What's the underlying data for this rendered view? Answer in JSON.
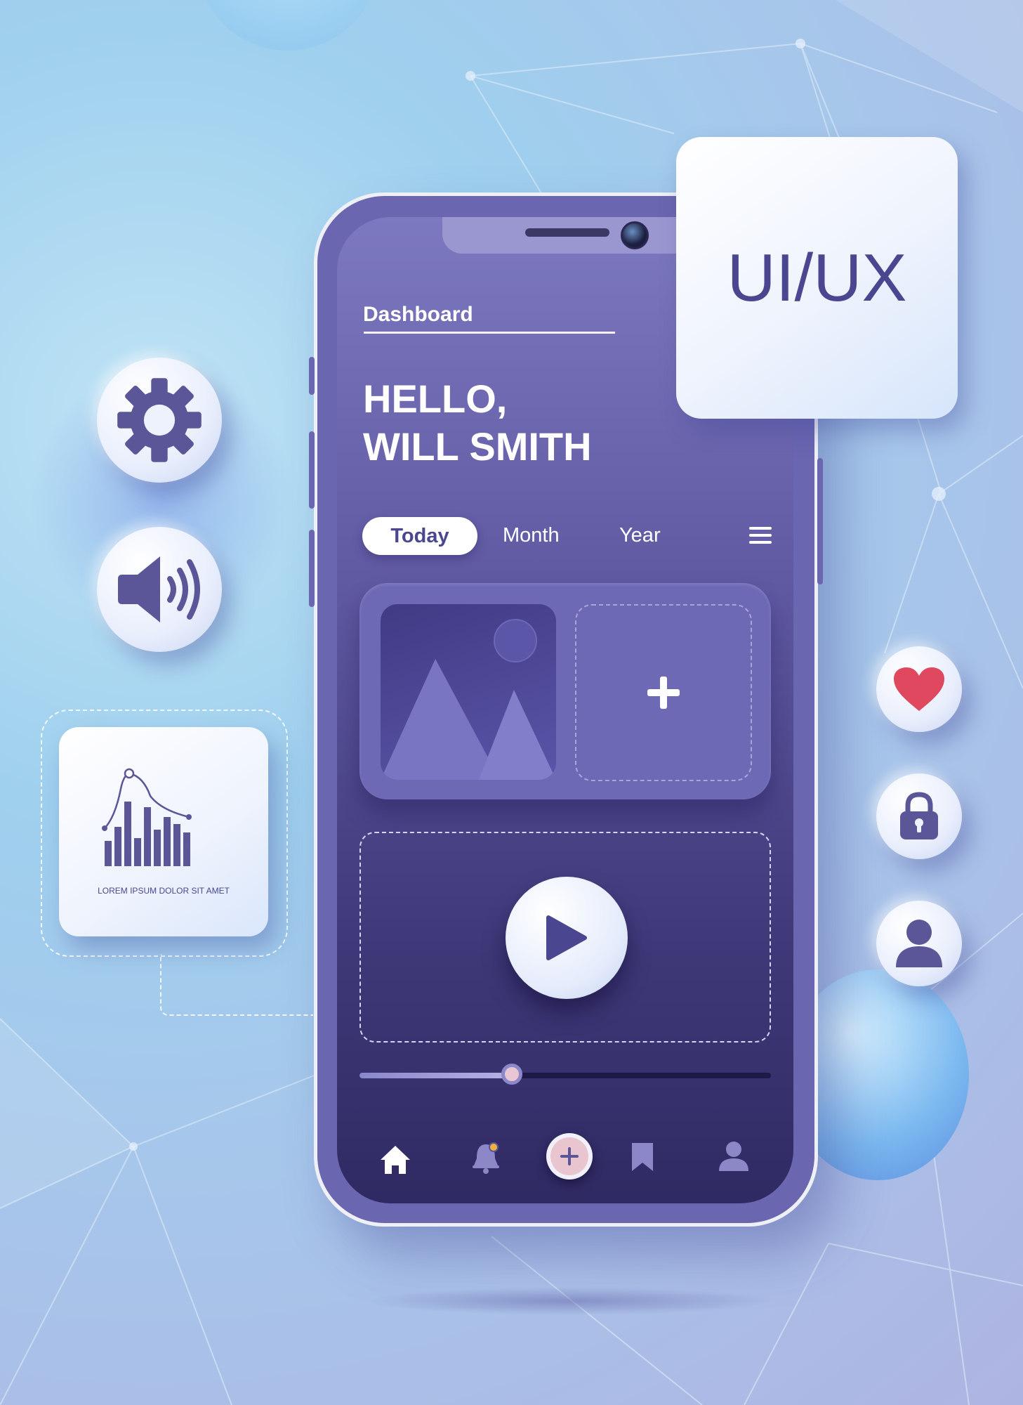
{
  "colors": {
    "accent": "#4a4790",
    "screen_top": "#7d79c0",
    "screen_bottom": "#302a63",
    "heart": "#e0485f",
    "nav_plus_bg": "#e9c6cf",
    "notification_dot": "#f2b03c"
  },
  "badge": {
    "text": "UI/UX"
  },
  "screen": {
    "title": "Dashboard",
    "greeting_line1": "HELLO,",
    "greeting_line2": "WILL SMITH",
    "tabs": [
      {
        "label": "Today",
        "active": true
      },
      {
        "label": "Month",
        "active": false
      },
      {
        "label": "Year",
        "active": false
      }
    ],
    "media": {
      "progress": 0.37
    },
    "nav": [
      "home-icon",
      "bell-icon",
      "plus-icon",
      "bookmark-icon",
      "user-icon"
    ]
  },
  "side_buttons_left": [
    "gear-icon",
    "speaker-icon"
  ],
  "side_buttons_right": [
    "heart-icon",
    "lock-icon",
    "user-icon"
  ],
  "stat_card": {
    "caption": "LOREM IPSUM DOLOR SIT AMET"
  }
}
